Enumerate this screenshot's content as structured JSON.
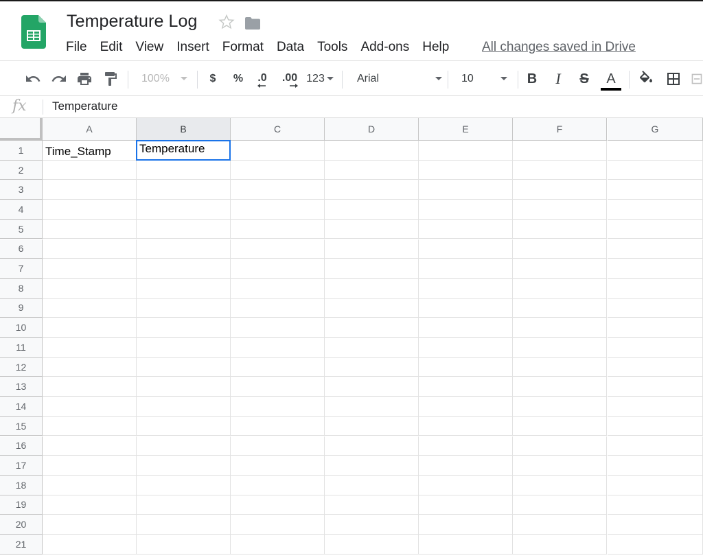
{
  "document": {
    "title": "Temperature Log",
    "save_status": "All changes saved in Drive"
  },
  "menu": [
    "File",
    "Edit",
    "View",
    "Insert",
    "Format",
    "Data",
    "Tools",
    "Add-ons",
    "Help"
  ],
  "toolbar": {
    "zoom": "100%",
    "currency_symbol": "$",
    "percent_symbol": "%",
    "decrease_decimal": ".0",
    "increase_decimal": ".00",
    "more_formats": "123",
    "font": "Arial",
    "font_size": "10",
    "bold": "B",
    "italic": "I",
    "strikethrough": "S",
    "text_color_letter": "A",
    "text_color": "#000000"
  },
  "formula_bar": {
    "fx_label": "fx",
    "value": "Temperature"
  },
  "sheet": {
    "columns": [
      "A",
      "B",
      "C",
      "D",
      "E",
      "F",
      "G"
    ],
    "rows": [
      "1",
      "2",
      "3",
      "4",
      "5",
      "6",
      "7",
      "8",
      "9",
      "10",
      "11",
      "12",
      "13",
      "14",
      "15",
      "16",
      "17",
      "18",
      "19",
      "20",
      "21"
    ],
    "active_column": "B",
    "selected_cell": "B1",
    "cells": {
      "A1": "Time_Stamp",
      "B1": "Temperature"
    }
  },
  "colors": {
    "selection": "#1a73e8",
    "sheets_green": "#0f9d58"
  }
}
